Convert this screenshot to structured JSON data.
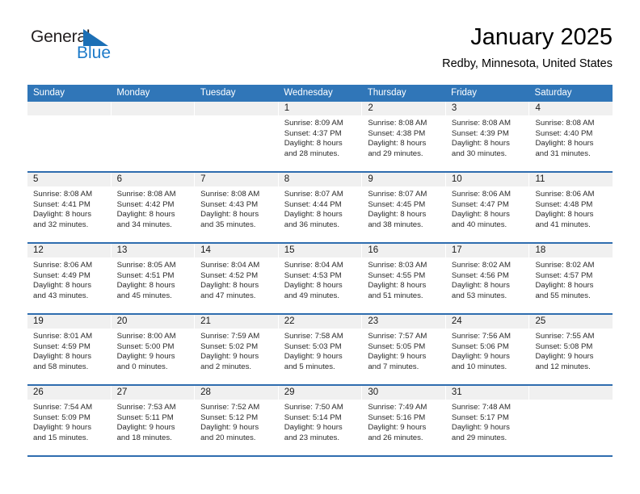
{
  "brand": {
    "name_part1": "General",
    "name_part2": "Blue",
    "triangle_icon": "triangle-icon",
    "accent_color": "#1c7ac9"
  },
  "header": {
    "month_year": "January 2025",
    "location": "Redby, Minnesota, United States"
  },
  "calendar": {
    "header_color": "#3076b8",
    "weekday_headers": [
      "Sunday",
      "Monday",
      "Tuesday",
      "Wednesday",
      "Thursday",
      "Friday",
      "Saturday"
    ],
    "labels": {
      "sunrise": "Sunrise:",
      "sunset": "Sunset:",
      "daylight": "Daylight:"
    },
    "weeks": [
      [
        {
          "day": "",
          "empty": true
        },
        {
          "day": "",
          "empty": true
        },
        {
          "day": "",
          "empty": true
        },
        {
          "day": "1",
          "sunrise": "Sunrise: 8:09 AM",
          "sunset": "Sunset: 4:37 PM",
          "daylight": "Daylight: 8 hours and 28 minutes."
        },
        {
          "day": "2",
          "sunrise": "Sunrise: 8:08 AM",
          "sunset": "Sunset: 4:38 PM",
          "daylight": "Daylight: 8 hours and 29 minutes."
        },
        {
          "day": "3",
          "sunrise": "Sunrise: 8:08 AM",
          "sunset": "Sunset: 4:39 PM",
          "daylight": "Daylight: 8 hours and 30 minutes."
        },
        {
          "day": "4",
          "sunrise": "Sunrise: 8:08 AM",
          "sunset": "Sunset: 4:40 PM",
          "daylight": "Daylight: 8 hours and 31 minutes."
        }
      ],
      [
        {
          "day": "5",
          "sunrise": "Sunrise: 8:08 AM",
          "sunset": "Sunset: 4:41 PM",
          "daylight": "Daylight: 8 hours and 32 minutes."
        },
        {
          "day": "6",
          "sunrise": "Sunrise: 8:08 AM",
          "sunset": "Sunset: 4:42 PM",
          "daylight": "Daylight: 8 hours and 34 minutes."
        },
        {
          "day": "7",
          "sunrise": "Sunrise: 8:08 AM",
          "sunset": "Sunset: 4:43 PM",
          "daylight": "Daylight: 8 hours and 35 minutes."
        },
        {
          "day": "8",
          "sunrise": "Sunrise: 8:07 AM",
          "sunset": "Sunset: 4:44 PM",
          "daylight": "Daylight: 8 hours and 36 minutes."
        },
        {
          "day": "9",
          "sunrise": "Sunrise: 8:07 AM",
          "sunset": "Sunset: 4:45 PM",
          "daylight": "Daylight: 8 hours and 38 minutes."
        },
        {
          "day": "10",
          "sunrise": "Sunrise: 8:06 AM",
          "sunset": "Sunset: 4:47 PM",
          "daylight": "Daylight: 8 hours and 40 minutes."
        },
        {
          "day": "11",
          "sunrise": "Sunrise: 8:06 AM",
          "sunset": "Sunset: 4:48 PM",
          "daylight": "Daylight: 8 hours and 41 minutes."
        }
      ],
      [
        {
          "day": "12",
          "sunrise": "Sunrise: 8:06 AM",
          "sunset": "Sunset: 4:49 PM",
          "daylight": "Daylight: 8 hours and 43 minutes."
        },
        {
          "day": "13",
          "sunrise": "Sunrise: 8:05 AM",
          "sunset": "Sunset: 4:51 PM",
          "daylight": "Daylight: 8 hours and 45 minutes."
        },
        {
          "day": "14",
          "sunrise": "Sunrise: 8:04 AM",
          "sunset": "Sunset: 4:52 PM",
          "daylight": "Daylight: 8 hours and 47 minutes."
        },
        {
          "day": "15",
          "sunrise": "Sunrise: 8:04 AM",
          "sunset": "Sunset: 4:53 PM",
          "daylight": "Daylight: 8 hours and 49 minutes."
        },
        {
          "day": "16",
          "sunrise": "Sunrise: 8:03 AM",
          "sunset": "Sunset: 4:55 PM",
          "daylight": "Daylight: 8 hours and 51 minutes."
        },
        {
          "day": "17",
          "sunrise": "Sunrise: 8:02 AM",
          "sunset": "Sunset: 4:56 PM",
          "daylight": "Daylight: 8 hours and 53 minutes."
        },
        {
          "day": "18",
          "sunrise": "Sunrise: 8:02 AM",
          "sunset": "Sunset: 4:57 PM",
          "daylight": "Daylight: 8 hours and 55 minutes."
        }
      ],
      [
        {
          "day": "19",
          "sunrise": "Sunrise: 8:01 AM",
          "sunset": "Sunset: 4:59 PM",
          "daylight": "Daylight: 8 hours and 58 minutes."
        },
        {
          "day": "20",
          "sunrise": "Sunrise: 8:00 AM",
          "sunset": "Sunset: 5:00 PM",
          "daylight": "Daylight: 9 hours and 0 minutes."
        },
        {
          "day": "21",
          "sunrise": "Sunrise: 7:59 AM",
          "sunset": "Sunset: 5:02 PM",
          "daylight": "Daylight: 9 hours and 2 minutes."
        },
        {
          "day": "22",
          "sunrise": "Sunrise: 7:58 AM",
          "sunset": "Sunset: 5:03 PM",
          "daylight": "Daylight: 9 hours and 5 minutes."
        },
        {
          "day": "23",
          "sunrise": "Sunrise: 7:57 AM",
          "sunset": "Sunset: 5:05 PM",
          "daylight": "Daylight: 9 hours and 7 minutes."
        },
        {
          "day": "24",
          "sunrise": "Sunrise: 7:56 AM",
          "sunset": "Sunset: 5:06 PM",
          "daylight": "Daylight: 9 hours and 10 minutes."
        },
        {
          "day": "25",
          "sunrise": "Sunrise: 7:55 AM",
          "sunset": "Sunset: 5:08 PM",
          "daylight": "Daylight: 9 hours and 12 minutes."
        }
      ],
      [
        {
          "day": "26",
          "sunrise": "Sunrise: 7:54 AM",
          "sunset": "Sunset: 5:09 PM",
          "daylight": "Daylight: 9 hours and 15 minutes."
        },
        {
          "day": "27",
          "sunrise": "Sunrise: 7:53 AM",
          "sunset": "Sunset: 5:11 PM",
          "daylight": "Daylight: 9 hours and 18 minutes."
        },
        {
          "day": "28",
          "sunrise": "Sunrise: 7:52 AM",
          "sunset": "Sunset: 5:12 PM",
          "daylight": "Daylight: 9 hours and 20 minutes."
        },
        {
          "day": "29",
          "sunrise": "Sunrise: 7:50 AM",
          "sunset": "Sunset: 5:14 PM",
          "daylight": "Daylight: 9 hours and 23 minutes."
        },
        {
          "day": "30",
          "sunrise": "Sunrise: 7:49 AM",
          "sunset": "Sunset: 5:16 PM",
          "daylight": "Daylight: 9 hours and 26 minutes."
        },
        {
          "day": "31",
          "sunrise": "Sunrise: 7:48 AM",
          "sunset": "Sunset: 5:17 PM",
          "daylight": "Daylight: 9 hours and 29 minutes."
        },
        {
          "day": "",
          "empty": true
        }
      ]
    ]
  }
}
